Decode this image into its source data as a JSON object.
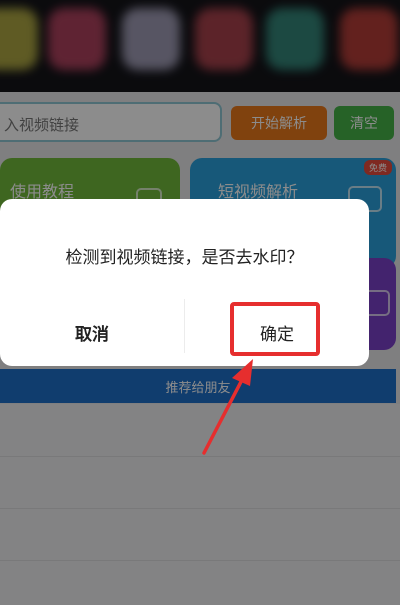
{
  "background_app": {
    "url_placeholder": "入视频链接",
    "start_button": "开始解析",
    "clear_button": "清空",
    "tutorial_card": "使用教程",
    "short_video_card": "短视频解析",
    "short_video_badge": "免费",
    "share_bar": "推荐给朋友"
  },
  "dialog": {
    "message": "检测到视频链接，是否去水印？",
    "cancel_label": "取消",
    "confirm_label": "确定"
  },
  "colors": {
    "highlight": "#e62e2e",
    "start_button": "#e9781a",
    "clear_button": "#46b248",
    "tutorial_card": "#72bb3b",
    "short_video_card": "#2aa0dc",
    "share_bar": "#1e6fc9"
  }
}
